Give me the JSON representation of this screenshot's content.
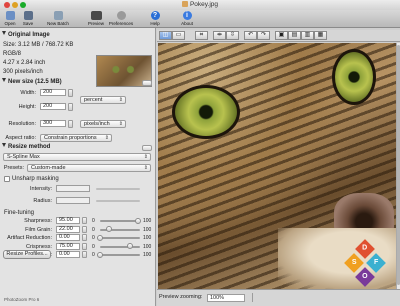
{
  "window": {
    "title": "Pokey.jpg"
  },
  "toolbar": {
    "open": "Open",
    "save": "Save",
    "new_batch": "New Batch",
    "preview": "Preview",
    "preferences": "Preferences",
    "help": "Help",
    "about": "About",
    "help_glyph": "?",
    "about_glyph": "i"
  },
  "original_image": {
    "header": "Original Image",
    "size": "Size: 3.12 MB / 768.72 KB",
    "mode": "RGB/8",
    "dimensions_in": "4.27 x 2.84 inch",
    "resolution": "300 pixels/inch"
  },
  "new_size": {
    "header": "New size (12.5 MB)",
    "width_label": "Width:",
    "width_value": "200",
    "height_label": "Height:",
    "height_value": "200",
    "unit": "percent",
    "resolution_label": "Resolution:",
    "resolution_value": "300",
    "resolution_unit": "pixels/inch",
    "aspect_label": "Aspect ratio:",
    "aspect_value": "Constrain proportions"
  },
  "resize_method": {
    "header": "Resize method",
    "method": "S-Spline Max",
    "presets_label": "Presets:",
    "presets_value": "Custom-made"
  },
  "unsharp": {
    "label": "Unsharp masking",
    "intensity_label": "Intensity:",
    "radius_label": "Radius:"
  },
  "fine_tuning": {
    "header": "Fine-tuning",
    "rows": [
      {
        "label": "Sharpness:",
        "value": "95.00",
        "min": "0",
        "max": "100",
        "level": 0.95
      },
      {
        "label": "Film Grain:",
        "value": "22.00",
        "min": "0",
        "max": "100",
        "level": 0.22
      },
      {
        "label": "Artifact Reduction:",
        "value": "0.00",
        "min": "0",
        "max": "100",
        "level": 0.0
      },
      {
        "label": "Crispness:",
        "value": "75.00",
        "min": "0",
        "max": "100",
        "level": 0.75
      },
      {
        "label": "Vividness:",
        "value": "0.00",
        "min": "0",
        "max": "100",
        "level": 0.0
      }
    ]
  },
  "resize_profiles": "Resize Profiles...",
  "footer": "PhotoZoom Pro 6",
  "statusbar": {
    "preview_zooming": "Preview zooming:",
    "zoom_value": "100%"
  },
  "watermark": {
    "letters": [
      "D",
      "S",
      "F",
      "O",
      "O",
      "A"
    ]
  },
  "colors": {
    "accent": "#6f9ad8",
    "sidebar_bg": "#e3e3e3"
  }
}
